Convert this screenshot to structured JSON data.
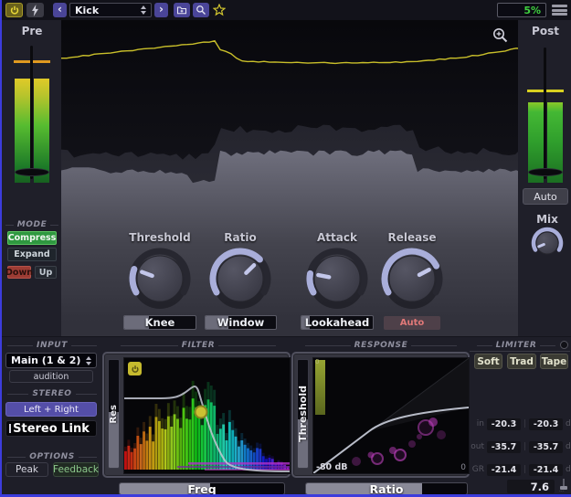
{
  "titlebar": {
    "preset": "Kick",
    "cpu": "5%"
  },
  "icons": {
    "prev": "‹",
    "next": "›"
  },
  "left_panel": {
    "pre": "Pre",
    "mode": {
      "header": "MODE",
      "compress": "Compress",
      "expand": "Expand",
      "down": "Down",
      "up": "Up"
    }
  },
  "right_panel": {
    "post": "Post",
    "auto": "Auto",
    "mix": "Mix",
    "mix_fraction": 0.03
  },
  "knobs": [
    {
      "label": "Threshold",
      "fraction": 0.21
    },
    {
      "label": "Ratio",
      "fraction": 0.69
    },
    {
      "label": "Attack",
      "fraction": 0.17
    },
    {
      "label": "Release",
      "fraction": 0.76
    }
  ],
  "knob_buttons": [
    {
      "label": "Knee",
      "fill": 0.35
    },
    {
      "label": "Window",
      "fill": 0.32
    },
    {
      "label": "Lookahead",
      "fill": 0.12
    }
  ],
  "release_auto": "Auto",
  "input_panel": {
    "header": "INPUT",
    "source": "Main (1 & 2)",
    "audition": "audition",
    "stereo_header": "STEREO",
    "stereo_mode": "Left + Right",
    "stereo_link": "Stereo Link",
    "options_header": "OPTIONS",
    "peak": "Peak",
    "feedback": "Feedback"
  },
  "filter_panel": {
    "header": "FILTER",
    "res_label": "Res",
    "res_fill": 0.52,
    "freq_label": "Freq",
    "freq_fill": 0.55
  },
  "response_panel": {
    "header": "RESPONSE",
    "threshold_label": "Threshold",
    "threshold_fill": 0.45,
    "ratio_label": "Ratio",
    "ratio_fill": 0.72,
    "db_min": "-80 dB",
    "db_max": "0",
    "zero_top": "0"
  },
  "limiter_panel": {
    "header": "LIMITER",
    "modes": [
      "Soft",
      "Trad",
      "Tape"
    ],
    "sep": "|",
    "rows": [
      {
        "label": "in",
        "left": "-20.3",
        "right": "-20.3",
        "unit": "dB"
      },
      {
        "label": "out",
        "left": "-35.7",
        "right": "-35.7",
        "unit": "dB"
      },
      {
        "label": "GR",
        "left": "-21.4",
        "right": "-21.4",
        "unit": "dB"
      }
    ],
    "release_value": "7.6"
  }
}
